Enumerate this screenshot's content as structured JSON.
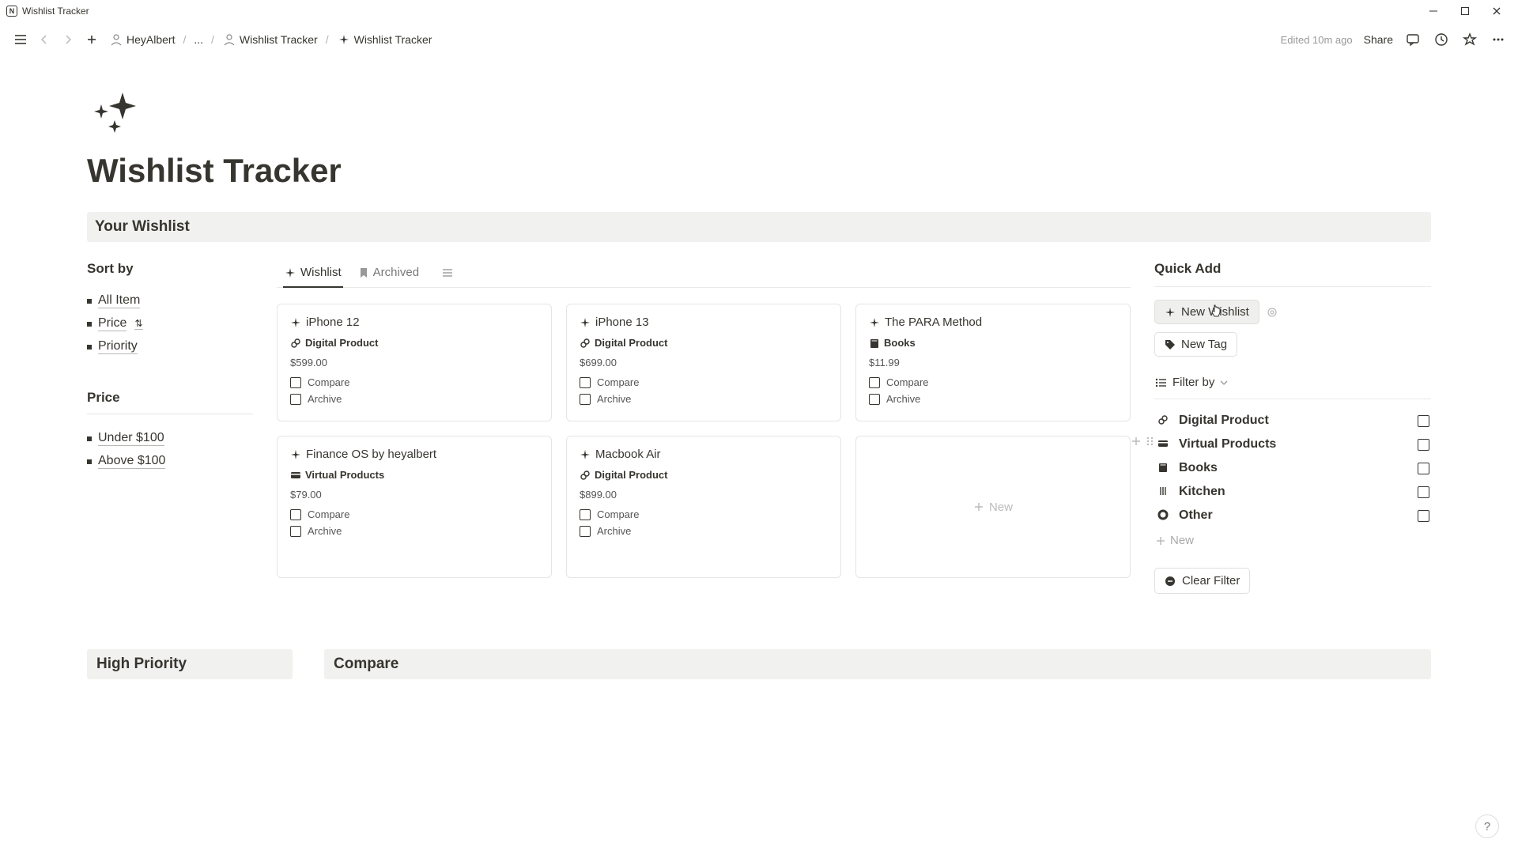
{
  "titlebar": {
    "app_name": "Wishlist Tracker"
  },
  "toolbar": {
    "breadcrumb": {
      "root": "HeyAlbert",
      "dots": "...",
      "parent": "Wishlist Tracker",
      "current": "Wishlist Tracker"
    },
    "edited": "Edited 10m ago",
    "share": "Share"
  },
  "page": {
    "title": "Wishlist Tracker",
    "section": "Your Wishlist"
  },
  "sort": {
    "heading": "Sort by",
    "items": [
      "All Item",
      "Price",
      "Priority"
    ]
  },
  "price": {
    "heading": "Price",
    "items": [
      "Under $100",
      "Above $100"
    ]
  },
  "tabs": {
    "wishlist": "Wishlist",
    "archived": "Archived"
  },
  "cards": [
    {
      "title": "iPhone 12",
      "tag": "Digital Product",
      "tag_icon": "link",
      "price": "$599.00",
      "compare": "Compare",
      "archive": "Archive"
    },
    {
      "title": "iPhone 13",
      "tag": "Digital Product",
      "tag_icon": "link",
      "price": "$699.00",
      "compare": "Compare",
      "archive": "Archive"
    },
    {
      "title": "The PARA Method",
      "tag": "Books",
      "tag_icon": "book",
      "price": "$11.99",
      "compare": "Compare",
      "archive": "Archive"
    },
    {
      "title": "Finance OS by heyalbert",
      "tag": "Virtual Products",
      "tag_icon": "card",
      "price": "$79.00",
      "compare": "Compare",
      "archive": "Archive"
    },
    {
      "title": "Macbook Air",
      "tag": "Digital Product",
      "tag_icon": "link",
      "price": "$899.00",
      "compare": "Compare",
      "archive": "Archive"
    }
  ],
  "new_card": "New",
  "quick": {
    "heading": "Quick Add",
    "new_wishlist": "New Wishlist",
    "new_tag": "New Tag"
  },
  "filter": {
    "heading": "Filter by",
    "items": [
      {
        "label": "Digital Product",
        "icon": "link"
      },
      {
        "label": "Virtual Products",
        "icon": "card"
      },
      {
        "label": "Books",
        "icon": "book"
      },
      {
        "label": "Kitchen",
        "icon": "utensils"
      },
      {
        "label": "Other",
        "icon": "circle"
      }
    ],
    "new": "New",
    "clear": "Clear Filter"
  },
  "bottom": {
    "high_priority": "High Priority",
    "compare": "Compare"
  }
}
